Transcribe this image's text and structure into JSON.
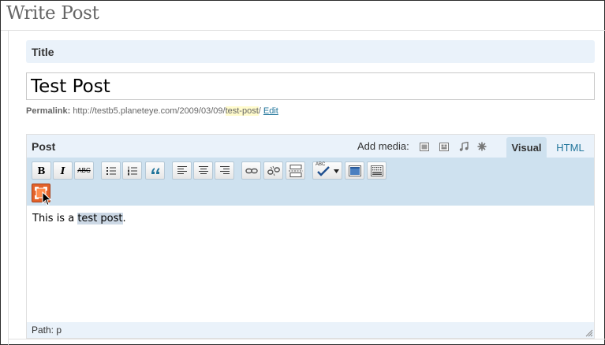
{
  "page": {
    "heading": "Write Post"
  },
  "title_section": {
    "label": "Title",
    "value": "Test Post"
  },
  "permalink": {
    "label": "Permalink:",
    "base_url": "http://testb5.planeteye.com/2009/03/09/",
    "slug": "test-post",
    "suffix": "/",
    "edit_label": "Edit"
  },
  "editor": {
    "label": "Post",
    "add_media_label": "Add media:",
    "media_icons": [
      "add-image-icon",
      "add-video-icon",
      "add-audio-icon",
      "add-media-icon"
    ],
    "tabs": [
      {
        "label": "Visual",
        "active": true
      },
      {
        "label": "HTML",
        "active": false
      }
    ],
    "toolbar_row1": [
      "bold",
      "italic",
      "strikethrough",
      "unordered-list",
      "ordered-list",
      "blockquote",
      "align-left",
      "align-center",
      "align-right",
      "link",
      "unlink",
      "insert-more",
      "spellcheck",
      "fullscreen-wide",
      "kitchen-sink"
    ],
    "toolbar_row2": [
      "fullscreen"
    ],
    "toolbar_labels": {
      "bold": "B",
      "italic": "I",
      "strikethrough": "ABC",
      "spellcheck": "ABC"
    },
    "content": {
      "prefix": "This is a ",
      "highlight": "test post",
      "suffix": "."
    },
    "status_path": "Path: p"
  },
  "colors": {
    "heading_gray": "#666666",
    "header_bg": "#eaf2fa",
    "toolbar_bg": "#cee1ef",
    "link_blue": "#21759b",
    "fullscreen_orange": "#e3622a",
    "slug_highlight": "#fffbcc"
  }
}
